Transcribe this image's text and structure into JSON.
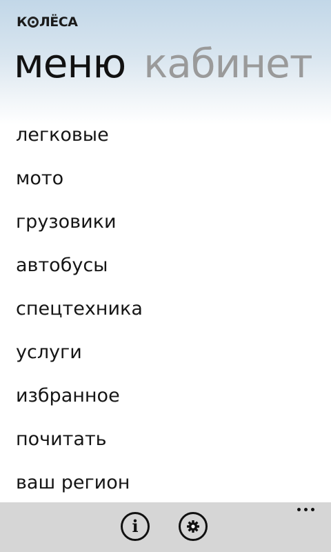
{
  "header": {
    "logo_text": "КОЛЁСА",
    "tabs": [
      {
        "label": "меню",
        "active": true
      },
      {
        "label": "кабинет",
        "active": false
      }
    ]
  },
  "menu": {
    "items": [
      {
        "label": "легковые"
      },
      {
        "label": "мото"
      },
      {
        "label": "грузовики"
      },
      {
        "label": "автобусы"
      },
      {
        "label": "спецтехника"
      },
      {
        "label": "услуги"
      },
      {
        "label": "избранное"
      },
      {
        "label": "почитать"
      },
      {
        "label": "ваш регион"
      }
    ]
  },
  "app_bar": {
    "buttons": [
      {
        "icon": "info-icon"
      },
      {
        "icon": "settings-icon"
      }
    ],
    "more_icon": "more-icon"
  },
  "colors": {
    "header_gradient_top": "#c2d7e8",
    "active_tab": "#111111",
    "inactive_tab": "#9a9a9a",
    "app_bar_bg": "#d6d6d6"
  }
}
